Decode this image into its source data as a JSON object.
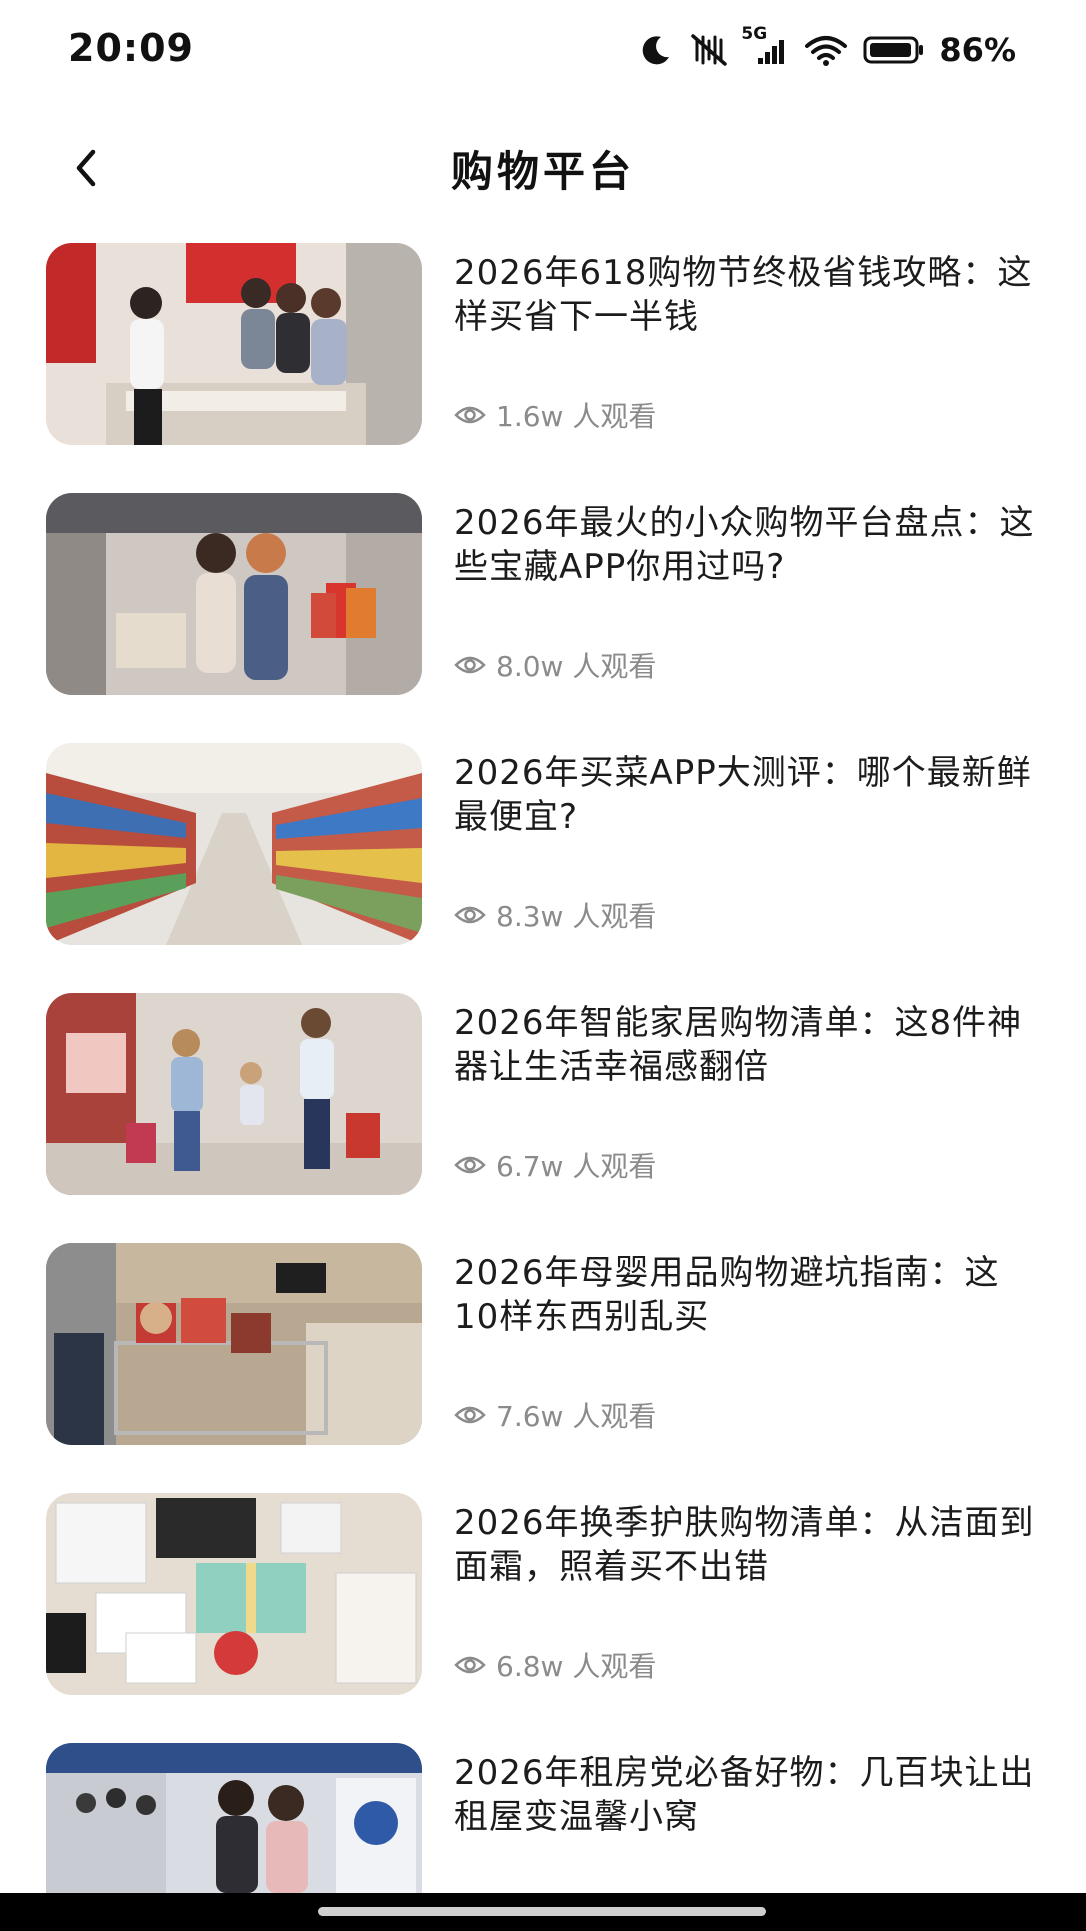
{
  "status": {
    "time": "20:09",
    "network": "5G",
    "battery": "86%",
    "icons": [
      "moon-icon",
      "silent-icon",
      "signal-icon",
      "wifi-icon",
      "battery-icon"
    ]
  },
  "header": {
    "title": "购物平台",
    "back_icon": "chevron-left-icon"
  },
  "articles": [
    {
      "title": "2026年618购物节终极省钱攻略：这样买省下一半钱",
      "views": "1.6w 人观看",
      "thumb": "store-counter"
    },
    {
      "title": "2026年最火的小众购物平台盘点：这些宝藏APP你用过吗?",
      "views": "8.0w 人观看",
      "thumb": "two-women-shopping-bags"
    },
    {
      "title": "2026年买菜APP大测评：哪个最新鲜最便宜?",
      "views": "8.3w 人观看",
      "thumb": "supermarket-aisle"
    },
    {
      "title": "2026年智能家居购物清单：这8件神器让生活幸福感翻倍",
      "views": "6.7w 人观看",
      "thumb": "family-in-mall"
    },
    {
      "title": "2026年母婴用品购物避坑指南：这10样东西别乱买",
      "views": "7.6w 人观看",
      "thumb": "shopping-cart-gifts"
    },
    {
      "title": "2026年换季护肤购物清单：从洁面到面霜，照着买不出错",
      "views": "6.8w 人观看",
      "thumb": "gift-boxes"
    },
    {
      "title": "2026年租房党必备好物：几百块让出租屋变温馨小窝",
      "views": "",
      "thumb": "store-checkout"
    }
  ],
  "colors": {
    "text": "#1c1c1c",
    "meta": "#8b8b8b",
    "background": "#ffffff"
  }
}
